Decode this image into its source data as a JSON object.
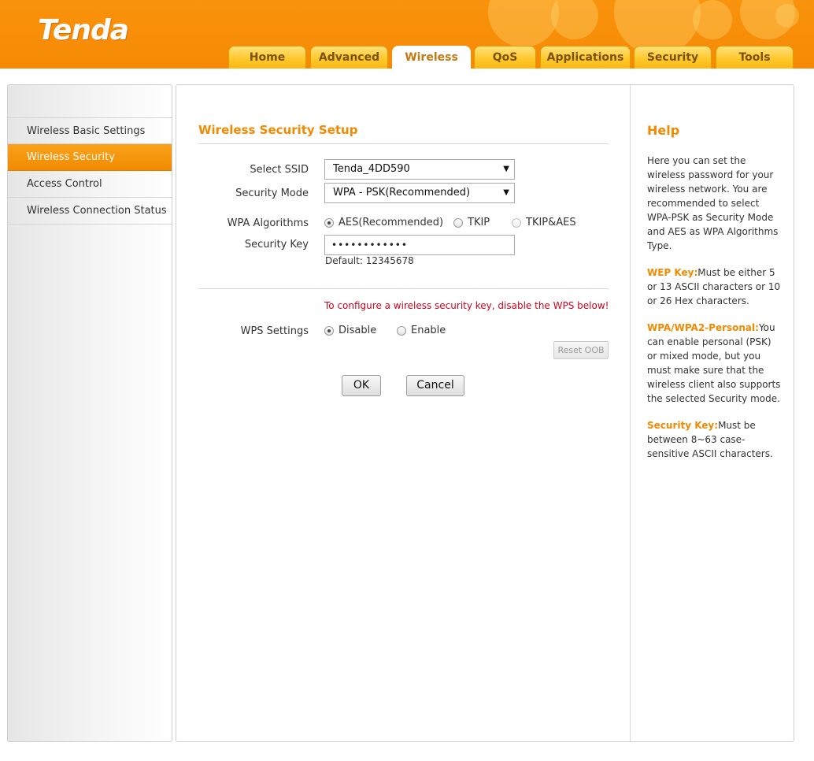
{
  "header": {
    "logo": "Tenda",
    "tabs": [
      "Home",
      "Advanced",
      "Wireless",
      "QoS",
      "Applications",
      "Security",
      "Tools"
    ],
    "active_tab": "Wireless"
  },
  "sidebar": {
    "items": [
      {
        "label": "Wireless Basic Settings"
      },
      {
        "label": "Wireless Security"
      },
      {
        "label": "Access Control"
      },
      {
        "label": "Wireless Connection Status"
      }
    ],
    "active": "Wireless Security"
  },
  "main": {
    "title": "Wireless Security Setup",
    "select_ssid_label": "Select SSID",
    "select_ssid_value": "Tenda_4DD590",
    "security_mode_label": "Security Mode",
    "security_mode_value": "WPA - PSK(Recommended)",
    "wpa_algorithms_label": "WPA Algorithms",
    "wpa_options": [
      "AES(Recommended)",
      "TKIP",
      "TKIP&AES"
    ],
    "wpa_selected": "AES(Recommended)",
    "security_key_label": "Security Key",
    "security_key_value": "••••••••••••",
    "default_note": "Default: 12345678",
    "warning": "To configure a wireless security key, disable the WPS below!",
    "wps_label": "WPS Settings",
    "wps_options": [
      "Disable",
      "Enable"
    ],
    "wps_selected": "Disable",
    "reset_oob": "Reset OOB",
    "ok": "OK",
    "cancel": "Cancel"
  },
  "help": {
    "title": "Help",
    "intro": "Here you can set the wireless password for your wireless network. You are recommended to select WPA-PSK as Security Mode and AES as WPA Algorithms Type.",
    "items": [
      {
        "key": "WEP Key:",
        "text": "Must be either 5 or 13 ASCII characters or 10 or 26 Hex characters."
      },
      {
        "key": "WPA/WPA2-Personal:",
        "text": "You can enable personal (PSK) or mixed mode, but you must make sure that the wireless client also supports the selected Security mode."
      },
      {
        "key": "Security Key:",
        "text": "Must be between 8~63 case-sensitive ASCII characters."
      }
    ]
  },
  "colors": {
    "header_orange": "#f68a05",
    "accent_orange": "#f08a00",
    "warning_red": "#d0021b"
  }
}
